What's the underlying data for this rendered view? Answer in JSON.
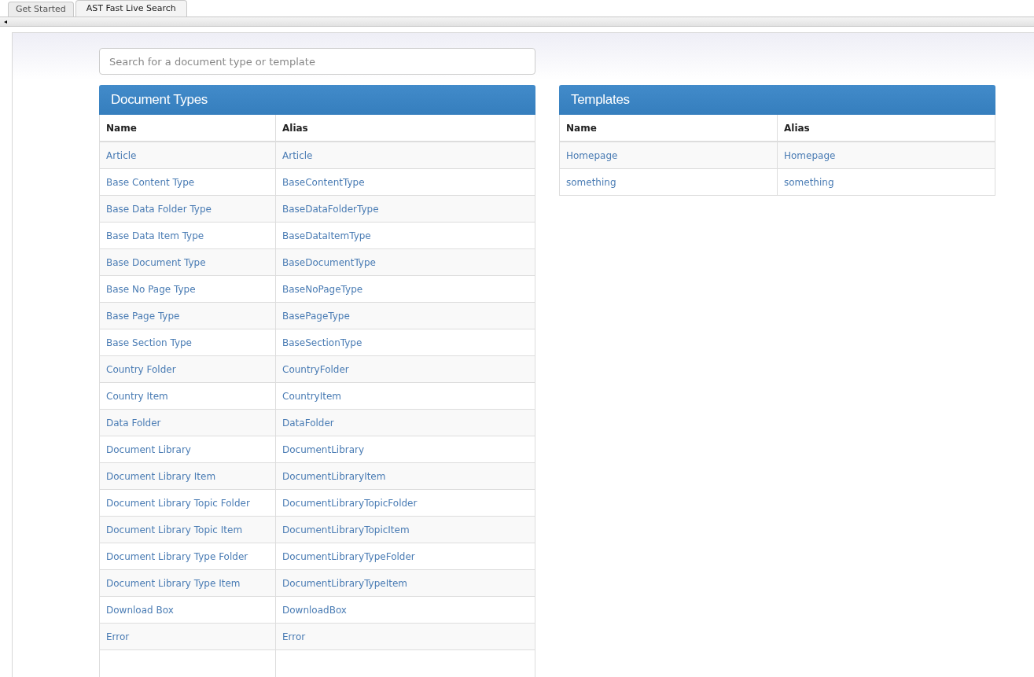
{
  "tabs": [
    {
      "label": "Get Started",
      "selected": false
    },
    {
      "label": "AST Fast Live Search",
      "selected": true
    }
  ],
  "toolbar": {
    "collapse_glyph": "◂"
  },
  "search": {
    "placeholder": "Search for a document type or template"
  },
  "panels": [
    {
      "title": "Document Types",
      "columns": [
        "Name",
        "Alias"
      ],
      "rows": [
        [
          "Article",
          "Article"
        ],
        [
          "Base Content Type",
          "BaseContentType"
        ],
        [
          "Base Data Folder Type",
          "BaseDataFolderType"
        ],
        [
          "Base Data Item Type",
          "BaseDataItemType"
        ],
        [
          "Base Document Type",
          "BaseDocumentType"
        ],
        [
          "Base No Page Type",
          "BaseNoPageType"
        ],
        [
          "Base Page Type",
          "BasePageType"
        ],
        [
          "Base Section Type",
          "BaseSectionType"
        ],
        [
          "Country Folder",
          "CountryFolder"
        ],
        [
          "Country Item",
          "CountryItem"
        ],
        [
          "Data Folder",
          "DataFolder"
        ],
        [
          "Document Library",
          "DocumentLibrary"
        ],
        [
          "Document Library Item",
          "DocumentLibraryItem"
        ],
        [
          "Document Library Topic Folder",
          "DocumentLibraryTopicFolder"
        ],
        [
          "Document Library Topic Item",
          "DocumentLibraryTopicItem"
        ],
        [
          "Document Library Type Folder",
          "DocumentLibraryTypeFolder"
        ],
        [
          "Document Library Type Item",
          "DocumentLibraryTypeItem"
        ],
        [
          "Download Box",
          "DownloadBox"
        ],
        [
          "Error",
          "Error"
        ]
      ]
    },
    {
      "title": "Templates",
      "columns": [
        "Name",
        "Alias"
      ],
      "rows": [
        [
          "Homepage",
          "Homepage"
        ],
        [
          "something",
          "something"
        ]
      ]
    }
  ]
}
